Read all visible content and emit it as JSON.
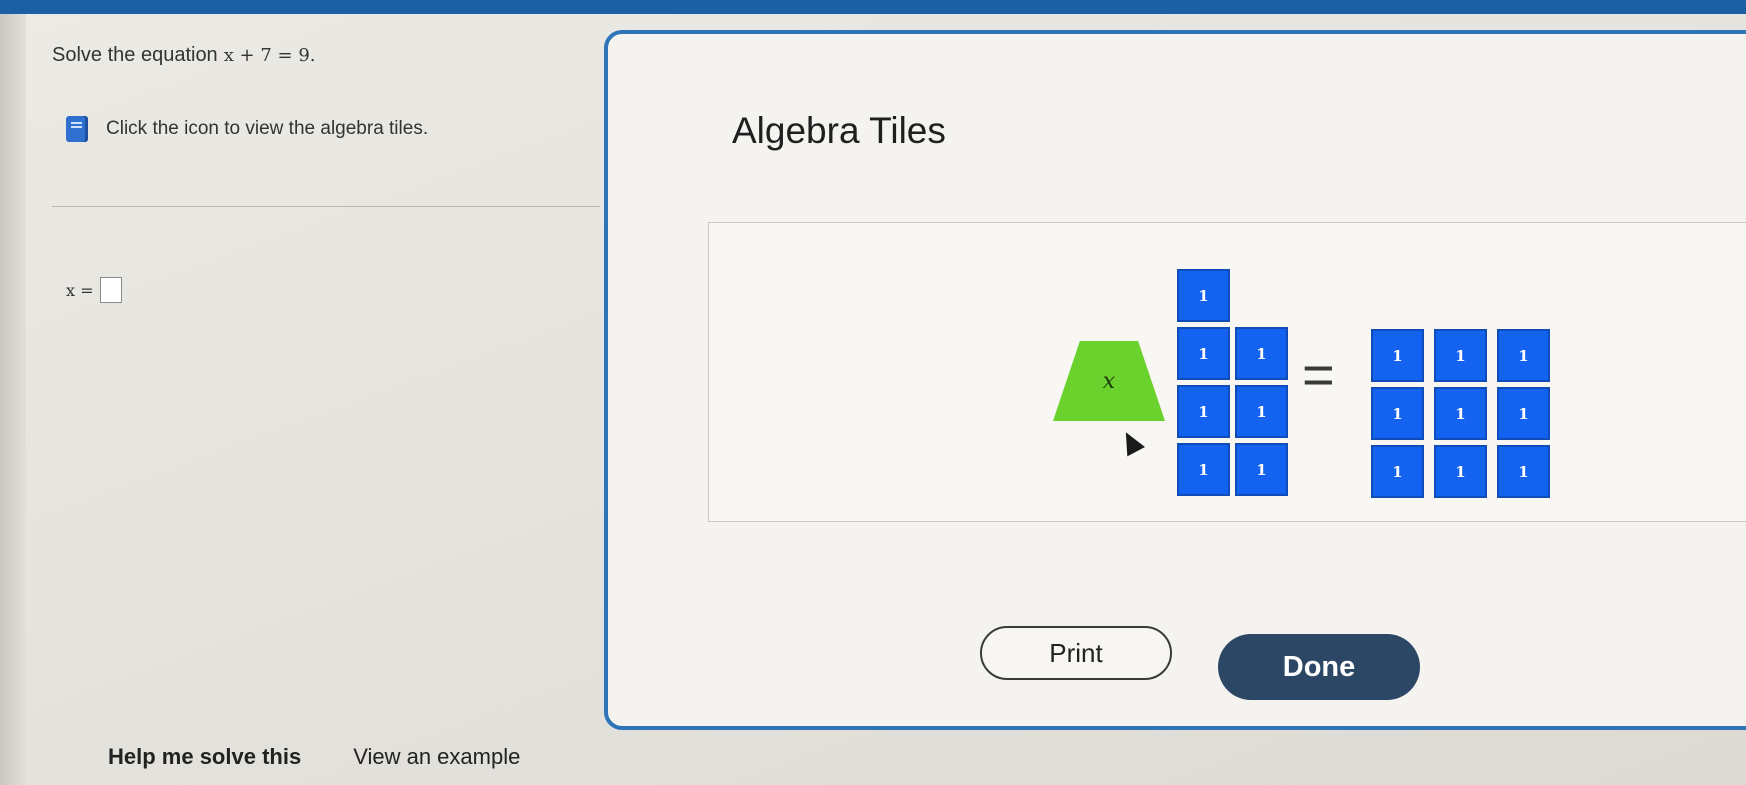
{
  "question": {
    "prompt": "Solve the equation",
    "equation": "x + 7 = 9."
  },
  "tiles_hint": {
    "text": "Click the icon to view the algebra tiles.",
    "icon": "book-icon"
  },
  "answer": {
    "label": "x =",
    "value": ""
  },
  "footer": {
    "help": "Help me solve this",
    "example": "View an example"
  },
  "modal": {
    "title": "Algebra Tiles",
    "x_tile_label": "x",
    "left_unit_labels": [
      "1",
      "1",
      "1",
      "1",
      "1",
      "1",
      "1"
    ],
    "equals": "=",
    "right_unit_labels": [
      "1",
      "1",
      "1",
      "1",
      "1",
      "1",
      "1",
      "1",
      "1"
    ],
    "print_label": "Print",
    "done_label": "Done"
  },
  "colors": {
    "accent_blue": "#2d74b8",
    "unit_tile": "#1363f0",
    "x_tile": "#6ad12d",
    "done_button": "#2c4765"
  }
}
